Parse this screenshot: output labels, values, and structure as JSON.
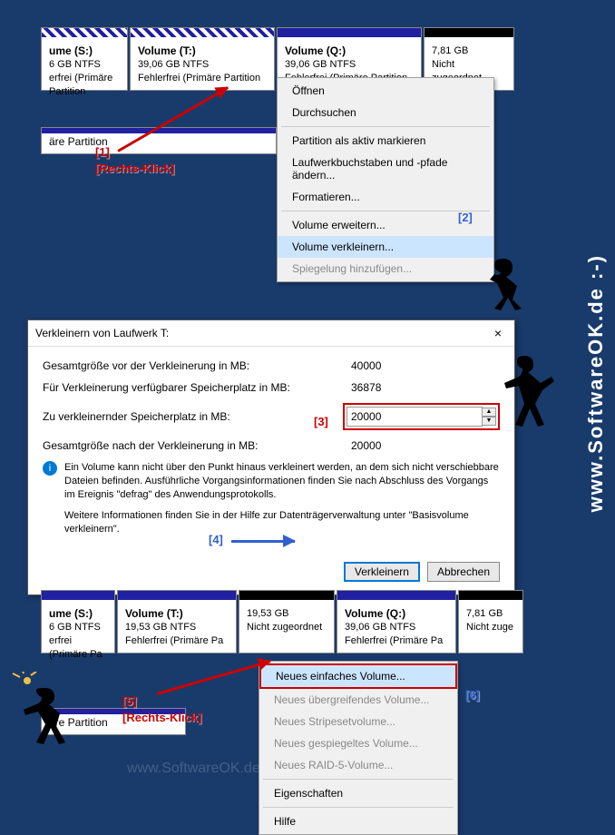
{
  "vertical_brand": "www.SoftwareOK.de :-)",
  "watermark": "www.SoftwareOK.de :-)",
  "section1": {
    "partitions": [
      {
        "title": "ume  (S:)",
        "line2": "6 GB NTFS",
        "line3": "erfrei (Primäre Partition"
      },
      {
        "title": "Volume  (T:)",
        "line2": "39,06 GB NTFS",
        "line3": "Fehlerfrei (Primäre Partition"
      },
      {
        "title": "Volume  (Q:)",
        "line2": "39,06 GB NTFS",
        "line3": "Fehlerfrei (Primäre Partition"
      },
      {
        "title": "",
        "line2": "7,81 GB",
        "line3": "Nicht zugeordnet"
      }
    ],
    "footer": "äre Partition",
    "menu": [
      "Öffnen",
      "Durchsuchen",
      "Partition als aktiv markieren",
      "Laufwerkbuchstaben und -pfade ändern...",
      "Formatieren...",
      "Volume erweitern...",
      "Volume verkleinern...",
      "Spiegelung hinzufügen..."
    ],
    "anno1": "[1]",
    "anno1b": "[Rechts-Klick]",
    "anno2": "[2]"
  },
  "dialog": {
    "title": "Verkleinern von Laufwerk T:",
    "labels": {
      "total": "Gesamtgröße vor der Verkleinerung in MB:",
      "avail": "Für Verkleinerung verfügbarer Speicherplatz in MB:",
      "shrink": "Zu verkleinernder Speicherplatz in MB:",
      "after": "Gesamtgröße nach der Verkleinerung in MB:"
    },
    "values": {
      "total": "40000",
      "avail": "36878",
      "shrink": "20000",
      "after": "20000"
    },
    "info1": "Ein Volume kann nicht über den Punkt hinaus verkleinert werden, an dem sich nicht verschiebbare Dateien befinden. Ausführliche Vorgangsinformationen finden Sie nach Abschluss des Vorgangs im Ereignis \"defrag\" des Anwendungsprotokolls.",
    "info2": "Weitere Informationen finden Sie in der Hilfe zur Datenträgerverwaltung unter \"Basisvolume verkleinern\".",
    "btn_ok": "Verkleinern",
    "btn_cancel": "Abbrechen",
    "anno3": "[3]",
    "anno4": "[4]"
  },
  "section3": {
    "partitions": [
      {
        "title": "ume  (S:)",
        "line2": "6 GB NTFS",
        "line3": "erfrei (Primäre Pa"
      },
      {
        "title": "Volume  (T:)",
        "line2": "19,53 GB NTFS",
        "line3": "Fehlerfrei (Primäre Pa"
      },
      {
        "title": "",
        "line2": "19,53 GB",
        "line3": "Nicht zugeordnet"
      },
      {
        "title": "Volume  (Q:)",
        "line2": "39,06 GB NTFS",
        "line3": "Fehlerfrei (Primäre Pa"
      },
      {
        "title": "",
        "line2": "7,81 GB",
        "line3": "Nicht zuge"
      }
    ],
    "footer": "äre Partition",
    "menu": [
      "Neues einfaches Volume...",
      "Neues übergreifendes Volume...",
      "Neues Stripesetvolume...",
      "Neues gespiegeltes Volume...",
      "Neues RAID-5-Volume...",
      "Eigenschaften",
      "Hilfe"
    ],
    "anno5": "[5]",
    "anno5b": "[Rechts-Klick]",
    "anno6": "[6]"
  }
}
